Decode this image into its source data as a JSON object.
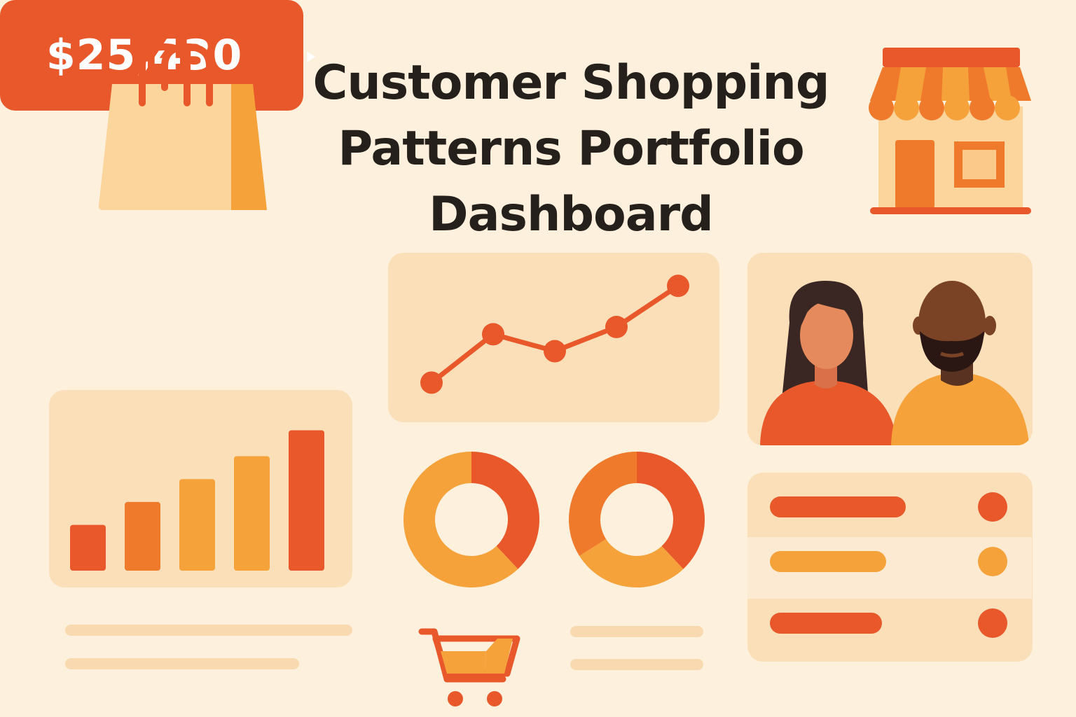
{
  "header": {
    "title_lines": [
      "Customer Shopping",
      "Patterns Portfolio",
      "Dashboard"
    ]
  },
  "kpi": {
    "value": "$25,430",
    "arrow_icon": "chevron-right-icon"
  },
  "icons": {
    "top_left": "shopping-bag-icon",
    "top_right": "storefront-icon",
    "bottom": "shopping-cart-icon"
  },
  "colors": {
    "background": "#fdf0dc",
    "card": "#fbdfb8",
    "primary_orange": "#e8582a",
    "accent_orange": "#f5a23a",
    "mid_orange": "#f07a2c",
    "text": "#26201c"
  },
  "chart_data": [
    {
      "type": "line",
      "x": [
        1,
        2,
        3,
        4,
        5
      ],
      "values": [
        1,
        3,
        2.3,
        3.3,
        5
      ],
      "ylim": [
        0,
        5.5
      ]
    },
    {
      "type": "bar",
      "values": [
        3,
        4.5,
        6,
        7.5,
        9.2
      ],
      "ylim": [
        0,
        10
      ],
      "colors": [
        "#e8582a",
        "#f07a2c",
        "#f5a23a",
        "#f5a23a",
        "#e8582a"
      ]
    },
    {
      "type": "pie",
      "values": [
        38,
        62
      ],
      "colors": [
        "#e8582a",
        "#f5a23a"
      ]
    },
    {
      "type": "pie",
      "values": [
        38,
        28,
        34
      ],
      "colors": [
        "#e8582a",
        "#f5a23a",
        "#f07a2c"
      ]
    }
  ],
  "list_items": [
    {
      "level": 0.9,
      "color": "#e8582a"
    },
    {
      "level": 0.76,
      "color": "#f5a23a"
    },
    {
      "level": 0.75,
      "color": "#e8582a"
    }
  ]
}
